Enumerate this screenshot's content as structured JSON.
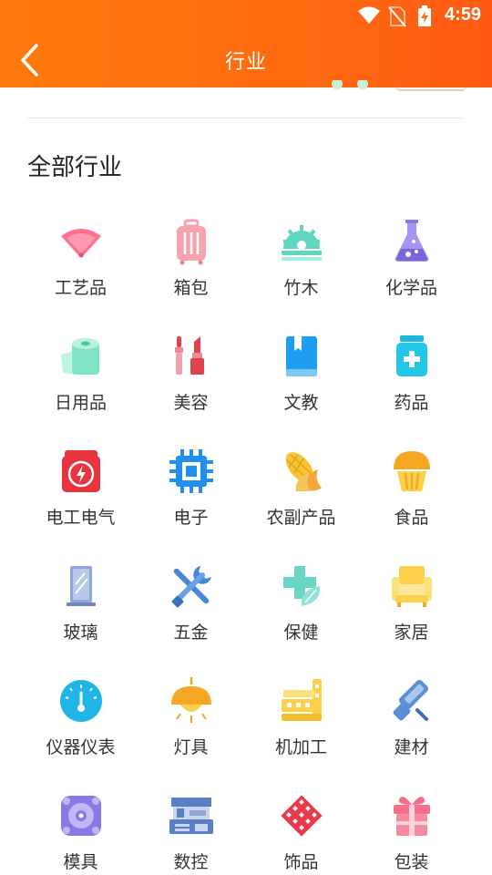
{
  "status_bar": {
    "time": "4:59"
  },
  "header": {
    "title": "行业"
  },
  "section": {
    "title": "全部行业"
  },
  "categories": [
    {
      "label": "工艺品",
      "icon": "fan-icon"
    },
    {
      "label": "箱包",
      "icon": "luggage-icon"
    },
    {
      "label": "竹木",
      "icon": "sawblade-icon"
    },
    {
      "label": "化学品",
      "icon": "flask-icon"
    },
    {
      "label": "日用品",
      "icon": "tissue-roll-icon"
    },
    {
      "label": "美容",
      "icon": "lipstick-icon"
    },
    {
      "label": "文教",
      "icon": "book-icon"
    },
    {
      "label": "药品",
      "icon": "medicine-bottle-icon"
    },
    {
      "label": "电工电气",
      "icon": "power-icon"
    },
    {
      "label": "电子",
      "icon": "chip-icon"
    },
    {
      "label": "农副产品",
      "icon": "corn-icon"
    },
    {
      "label": "食品",
      "icon": "muffin-icon"
    },
    {
      "label": "玻璃",
      "icon": "glass-pane-icon"
    },
    {
      "label": "五金",
      "icon": "tools-icon"
    },
    {
      "label": "保健",
      "icon": "health-cross-icon"
    },
    {
      "label": "家居",
      "icon": "sofa-icon"
    },
    {
      "label": "仪器仪表",
      "icon": "gauge-icon"
    },
    {
      "label": "灯具",
      "icon": "lamp-icon"
    },
    {
      "label": "机加工",
      "icon": "machine-icon"
    },
    {
      "label": "建材",
      "icon": "paint-roller-icon"
    },
    {
      "label": "模具",
      "icon": "mold-icon"
    },
    {
      "label": "数控",
      "icon": "cnc-icon"
    },
    {
      "label": "饰品",
      "icon": "diamond-ornament-icon"
    },
    {
      "label": "包装",
      "icon": "gift-box-icon"
    }
  ],
  "colors": {
    "header_start": "#ff7a0c",
    "header_end": "#ff5a12",
    "text": "#333333"
  }
}
